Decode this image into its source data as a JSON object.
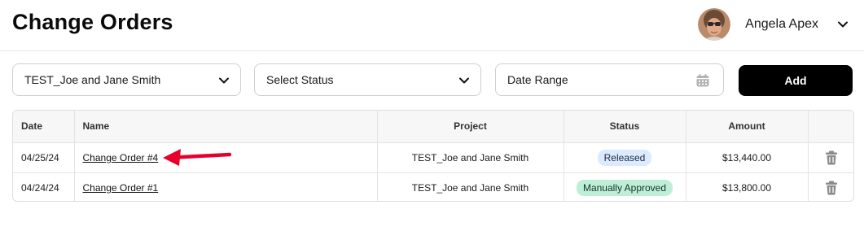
{
  "header": {
    "title": "Change Orders",
    "user_name": "Angela Apex"
  },
  "filters": {
    "project_value": "TEST_Joe and Jane Smith",
    "status_value": "Select Status",
    "date_range_value": "Date Range",
    "add_label": "Add"
  },
  "table": {
    "columns": {
      "date": "Date",
      "name": "Name",
      "project": "Project",
      "status": "Status",
      "amount": "Amount"
    },
    "rows": [
      {
        "date": "04/25/24",
        "name": "Change Order #4",
        "project": "TEST_Joe and Jane Smith",
        "status": "Released",
        "amount": "$13,440.00"
      },
      {
        "date": "04/24/24",
        "name": "Change Order #1",
        "project": "TEST_Joe and Jane Smith",
        "status": "Manually Approved",
        "amount": "$13,800.00"
      }
    ]
  },
  "icons": {
    "user_menu": "chevron-down-icon",
    "select": "chevron-down-icon",
    "date": "calendar-icon",
    "row_action": "trash-icon",
    "annotation": "red-arrow-icon"
  },
  "colors": {
    "add_button_bg": "#000000",
    "released_badge_bg": "#dbeafe",
    "approved_badge_bg": "#bfeed8",
    "annotation_arrow": "#e8002d",
    "trash_icon": "#8a8a8a"
  }
}
